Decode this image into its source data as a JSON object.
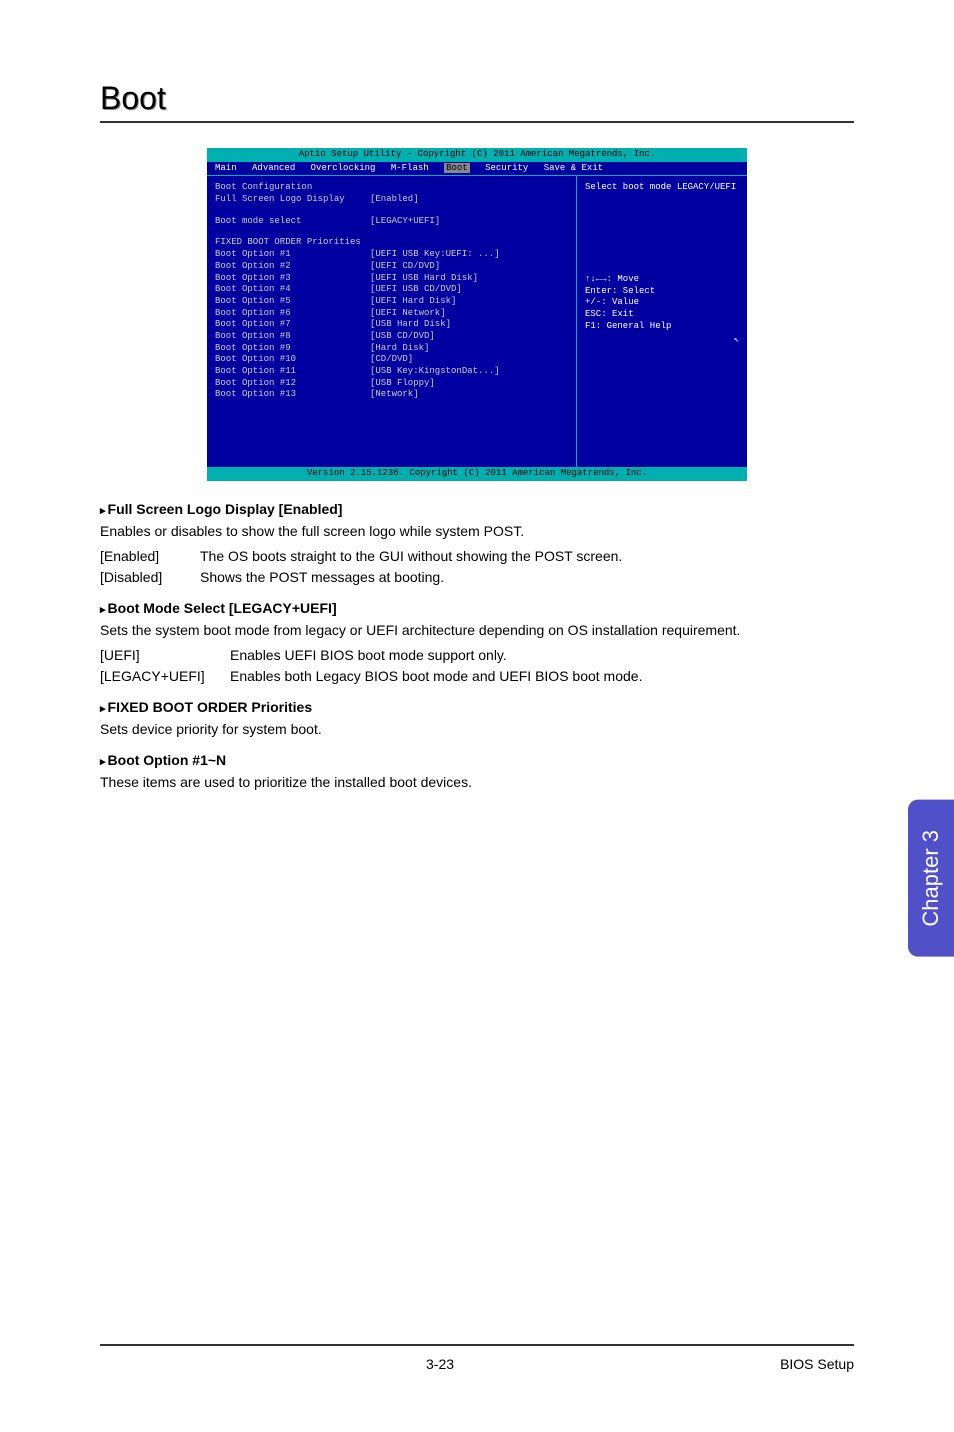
{
  "page_title": "Boot",
  "bios": {
    "header": "Aptio Setup Utility - Copyright (C) 2011 American Megatrends, Inc.",
    "menu": [
      "Main",
      "Advanced",
      "Overclocking",
      "M-Flash",
      "Boot",
      "Security",
      "Save & Exit"
    ],
    "selected_menu": "Boot",
    "config_title": "Boot Configuration",
    "logo_label": "Full Screen Logo Display",
    "logo_value": "[Enabled]",
    "mode_label": "Boot mode select",
    "mode_value": "[LEGACY+UEFI]",
    "priorities_title": "FIXED BOOT ORDER Priorities",
    "options": [
      {
        "label": "Boot Option #1",
        "value": "[UEFI USB Key:UEFI: ...]"
      },
      {
        "label": "Boot Option #2",
        "value": "[UEFI CD/DVD]"
      },
      {
        "label": "Boot Option #3",
        "value": "[UEFI USB Hard Disk]"
      },
      {
        "label": "Boot Option #4",
        "value": "[UEFI USB CD/DVD]"
      },
      {
        "label": "Boot Option #5",
        "value": "[UEFI Hard Disk]"
      },
      {
        "label": "Boot Option #6",
        "value": "[UEFI Network]"
      },
      {
        "label": "Boot Option #7",
        "value": "[USB Hard Disk]"
      },
      {
        "label": "Boot Option #8",
        "value": "[USB CD/DVD]"
      },
      {
        "label": "Boot Option #9",
        "value": "[Hard Disk]"
      },
      {
        "label": "Boot Option #10",
        "value": "[CD/DVD]"
      },
      {
        "label": "Boot Option #11",
        "value": "[USB Key:KingstonDat...]"
      },
      {
        "label": "Boot Option #12",
        "value": "[USB Floppy]"
      },
      {
        "label": "Boot Option #13",
        "value": "[Network]"
      }
    ],
    "help_title": "Select boot mode LEGACY/UEFI",
    "help_keys": [
      "↑↓←→: Move",
      "Enter: Select",
      "+/-: Value",
      "ESC: Exit",
      "F1: General Help"
    ],
    "footer": "Version 2.15.1236. Copyright (C) 2011 American Megatrends, Inc."
  },
  "sections": {
    "logo": {
      "header": "Full Screen Logo Display [Enabled]",
      "desc": "Enables or disables to show the full screen logo while system POST.",
      "opts": [
        {
          "k": "[Enabled]",
          "v": "The OS boots straight to the GUI without showing the POST screen."
        },
        {
          "k": "[Disabled]",
          "v": "Shows the POST messages at booting."
        }
      ]
    },
    "mode": {
      "header": "Boot Mode Select [LEGACY+UEFI]",
      "desc": "Sets the system boot mode from legacy or UEFI architecture depending on OS installation requirement.",
      "opts": [
        {
          "k": "[UEFI]",
          "v": "Enables UEFI BIOS boot mode support only."
        },
        {
          "k": "[LEGACY+UEFI]",
          "v": "Enables both Legacy BIOS boot mode and UEFI BIOS boot mode."
        }
      ]
    },
    "fixed": {
      "header": "FIXED BOOT ORDER Priorities",
      "desc": "Sets device priority for system boot."
    },
    "bootn": {
      "header": "Boot Option #1~N",
      "desc": "These items are used to prioritize the installed boot devices."
    }
  },
  "chapter_tab": "Chapter 3",
  "footer_page": "3-23",
  "footer_section": "BIOS Setup"
}
